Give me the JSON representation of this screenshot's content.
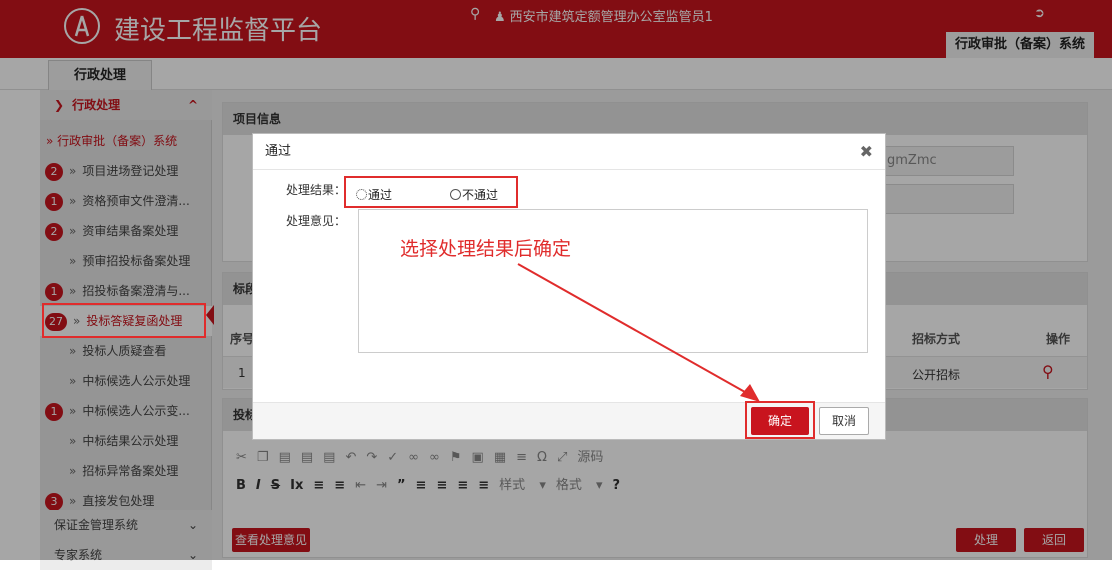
{
  "header": {
    "app_title": "建设工程监督平台",
    "user": "西安市建筑定额管理办公室监管员1",
    "system_tab": "行政审批（备案）系统",
    "search_icon": "search-icon",
    "user_icon": "user-icon",
    "logout_icon": "logout-icon"
  },
  "tabs": {
    "active": "行政处理"
  },
  "sidebar": {
    "group_title": "行政处理",
    "group_toggle": "^",
    "sub_title": "» 行政审批（备案）系统",
    "items": [
      {
        "badge": "2",
        "label": "项目进场登记处理"
      },
      {
        "badge": "1",
        "label": "资格预审文件澄清..."
      },
      {
        "badge": "2",
        "label": "资审结果备案处理"
      },
      {
        "badge": "",
        "label": "预审招投标备案处理"
      },
      {
        "badge": "1",
        "label": "招投标备案澄清与..."
      },
      {
        "badge": "27",
        "label": "投标答疑复函处理"
      },
      {
        "badge": "",
        "label": "投标人质疑查看"
      },
      {
        "badge": "",
        "label": "中标候选人公示处理"
      },
      {
        "badge": "1",
        "label": "中标候选人公示变..."
      },
      {
        "badge": "",
        "label": "中标结果公示处理"
      },
      {
        "badge": "",
        "label": "招标异常备案处理"
      },
      {
        "badge": "3",
        "label": "直接发包处理"
      }
    ],
    "bottom_items": [
      "保证金管理系统",
      "专家系统"
    ]
  },
  "main": {
    "project_panel_title": "项目信息",
    "field_value_partial": "gmZmc",
    "section_label": "标段",
    "table": {
      "col_no": "序号",
      "col_method": "招标方式",
      "col_action": "操作",
      "row": {
        "no": "1",
        "method": "公开招标"
      }
    },
    "answer_label": "投标",
    "toolbar_row2_text": "样式",
    "toolbar_row2_text2": "格式",
    "source_label": "源码",
    "view_opinion_button": "查看处理意见",
    "process_button": "处理",
    "back_button": "返回"
  },
  "modal": {
    "title": "通过",
    "result_label": "处理结果：",
    "option_pass": "通过",
    "option_fail": "不通过",
    "opinion_label": "处理意见：",
    "hint": "选择处理结果后确定",
    "ok_label": "确定",
    "cancel_label": "取消",
    "close_icon": "close-icon"
  },
  "colors": {
    "brand": "#c8141e",
    "annotation": "#e02c2c"
  }
}
